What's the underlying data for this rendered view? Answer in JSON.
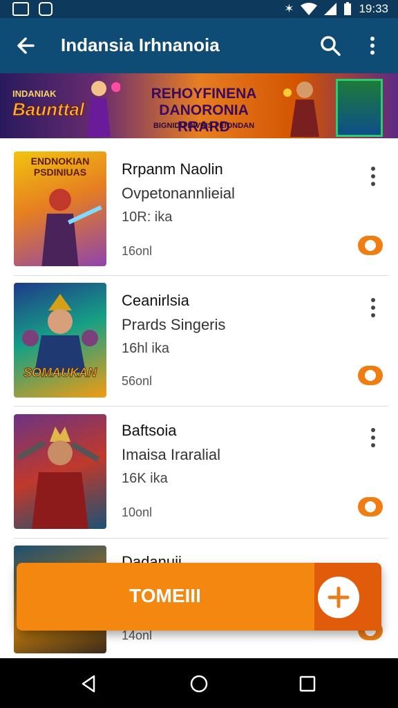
{
  "status": {
    "time": "19:33"
  },
  "appbar": {
    "title": "Indansia Irhnanoia"
  },
  "banner": {
    "logo_small": "INDANIAK",
    "logo_big": "Baunttal",
    "headline": "REHOYFINENA DANORONIA RRARD",
    "subline": "BIGNIDU DIVRIS | EIONDAN"
  },
  "items": [
    {
      "name": "Rrpanm Naolin",
      "subtitle": "Ovpetonannlieial",
      "meta": "10R: ika",
      "size": "16onl",
      "poster_text": "ENDNOKIAN PSDINIUAS"
    },
    {
      "name": "Ceanirlsia",
      "subtitle": "Prards Singeris",
      "meta": "16hl ika",
      "size": "56onl",
      "poster_text": "SOMAUKAN"
    },
    {
      "name": "Baftsoia",
      "subtitle": "Imaisa Iraralial",
      "meta": "16K ika",
      "size": "10onl",
      "poster_text": ""
    },
    {
      "name": "Dadanuii",
      "subtitle": "",
      "meta": "",
      "size": "14onl",
      "poster_text": ""
    }
  ],
  "fab": {
    "label": "TOMEIII"
  },
  "colors": {
    "statusbar": "#0d3a5c",
    "appbar": "#0f4c75",
    "accent": "#f3870f",
    "toggle": "#ef7d12"
  }
}
